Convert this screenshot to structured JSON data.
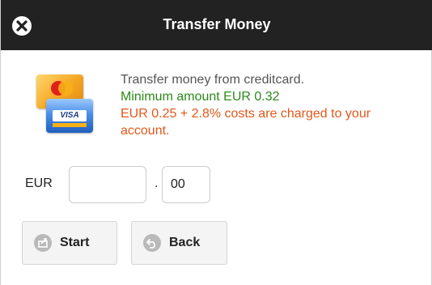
{
  "dialog": {
    "title": "Transfer Money"
  },
  "info": {
    "description": "Transfer money from creditcard.",
    "minimum": "Minimum amount EUR 0.32",
    "costs": "EUR 0.25 + 2.8% costs are charged to your account."
  },
  "cards": {
    "mastercard_text": "MasterCard",
    "visa_text": "VISA"
  },
  "amount": {
    "currency": "EUR",
    "major_value": "",
    "separator": ".",
    "minor_value": "00"
  },
  "buttons": {
    "start_label": "Start",
    "back_label": "Back"
  },
  "icons": {
    "close": "close-icon",
    "cards": "credit-cards-icon",
    "start": "share-icon",
    "back": "back-icon"
  },
  "colors": {
    "titlebar": "#222222",
    "minimum_text": "#2b8a1a",
    "costs_text": "#e2581b",
    "description_text": "#555555"
  }
}
